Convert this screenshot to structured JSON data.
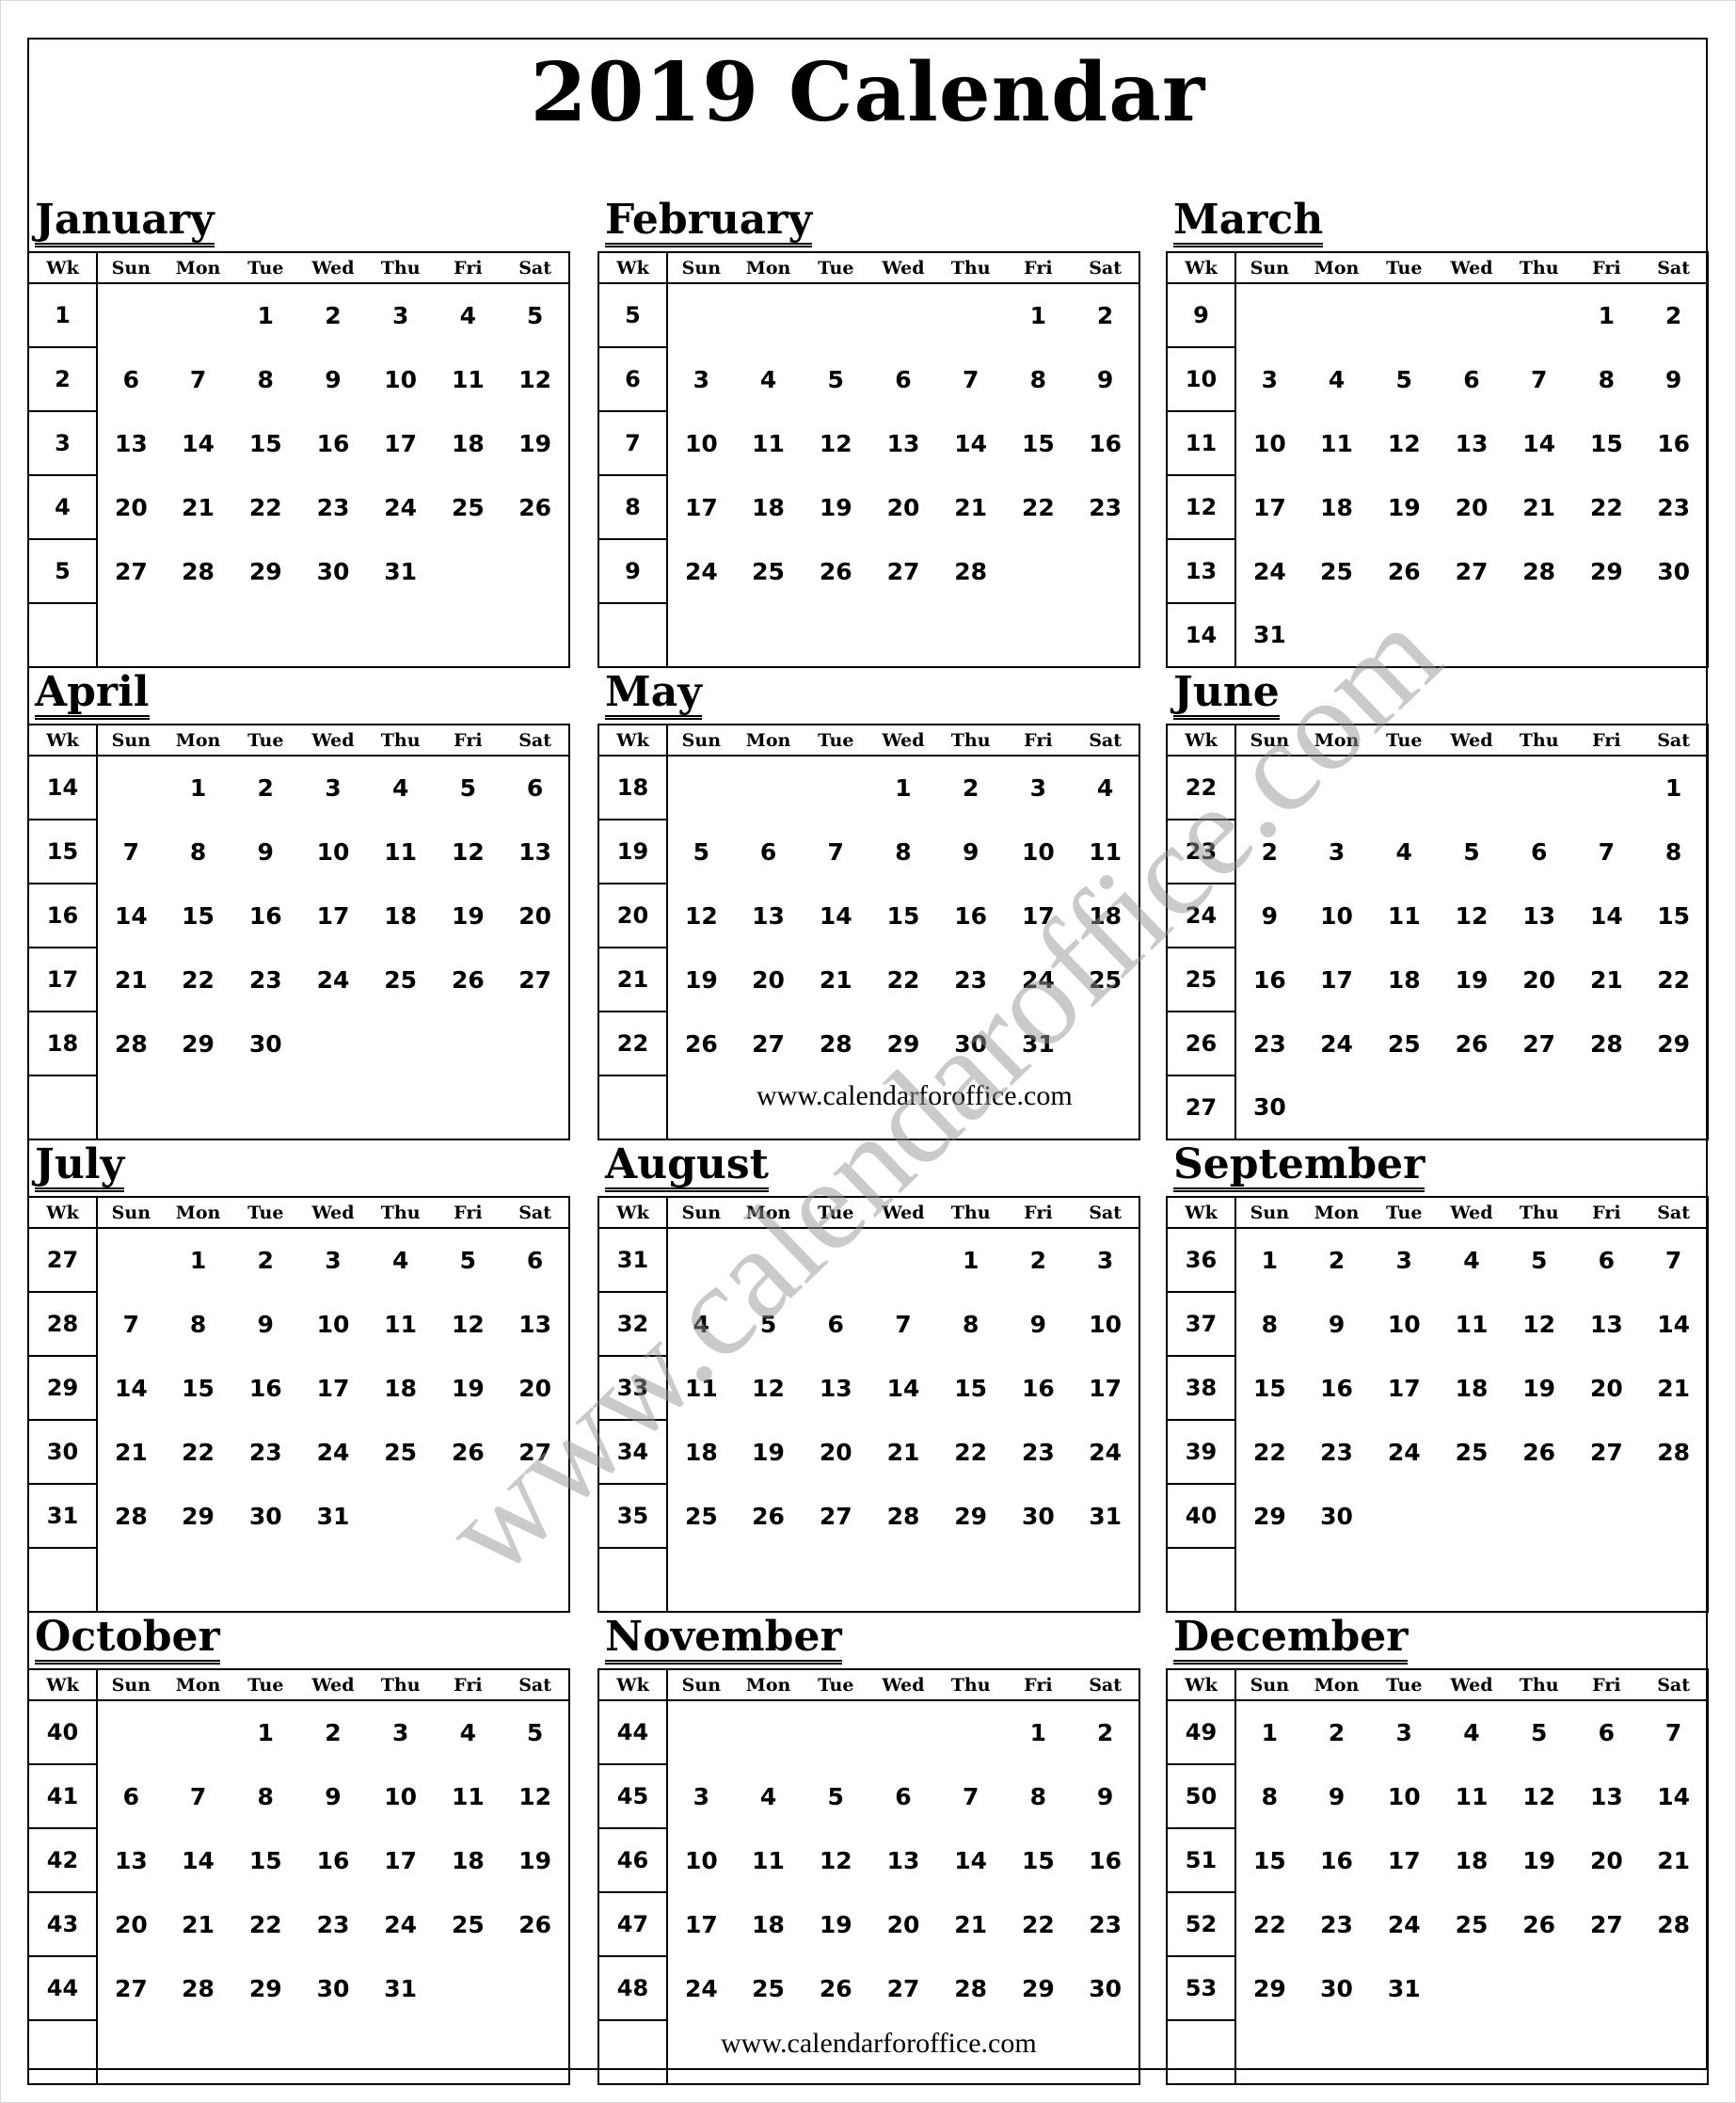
{
  "title": "2019 Calendar",
  "weekday_headers": [
    "Wk",
    "Sun",
    "Mon",
    "Tue",
    "Wed",
    "Thu",
    "Fri",
    "Sat"
  ],
  "watermark": "www.calendaroffice.com",
  "footer_urls": [
    "www.calendarforoffice.com",
    "www.calendarforoffice.com"
  ],
  "months": [
    {
      "name": "January",
      "weeks": [
        {
          "wk": "1",
          "days": [
            "",
            "",
            "1",
            "2",
            "3",
            "4",
            "5"
          ]
        },
        {
          "wk": "2",
          "days": [
            "6",
            "7",
            "8",
            "9",
            "10",
            "11",
            "12"
          ]
        },
        {
          "wk": "3",
          "days": [
            "13",
            "14",
            "15",
            "16",
            "17",
            "18",
            "19"
          ]
        },
        {
          "wk": "4",
          "days": [
            "20",
            "21",
            "22",
            "23",
            "24",
            "25",
            "26"
          ]
        },
        {
          "wk": "5",
          "days": [
            "27",
            "28",
            "29",
            "30",
            "31",
            "",
            ""
          ]
        },
        {
          "wk": "",
          "days": [
            "",
            "",
            "",
            "",
            "",
            "",
            ""
          ]
        }
      ]
    },
    {
      "name": "February",
      "weeks": [
        {
          "wk": "5",
          "days": [
            "",
            "",
            "",
            "",
            "",
            "1",
            "2"
          ]
        },
        {
          "wk": "6",
          "days": [
            "3",
            "4",
            "5",
            "6",
            "7",
            "8",
            "9"
          ]
        },
        {
          "wk": "7",
          "days": [
            "10",
            "11",
            "12",
            "13",
            "14",
            "15",
            "16"
          ]
        },
        {
          "wk": "8",
          "days": [
            "17",
            "18",
            "19",
            "20",
            "21",
            "22",
            "23"
          ]
        },
        {
          "wk": "9",
          "days": [
            "24",
            "25",
            "26",
            "27",
            "28",
            "",
            ""
          ]
        },
        {
          "wk": "",
          "days": [
            "",
            "",
            "",
            "",
            "",
            "",
            ""
          ]
        }
      ]
    },
    {
      "name": "March",
      "weeks": [
        {
          "wk": "9",
          "days": [
            "",
            "",
            "",
            "",
            "",
            "1",
            "2"
          ]
        },
        {
          "wk": "10",
          "days": [
            "3",
            "4",
            "5",
            "6",
            "7",
            "8",
            "9"
          ]
        },
        {
          "wk": "11",
          "days": [
            "10",
            "11",
            "12",
            "13",
            "14",
            "15",
            "16"
          ]
        },
        {
          "wk": "12",
          "days": [
            "17",
            "18",
            "19",
            "20",
            "21",
            "22",
            "23"
          ]
        },
        {
          "wk": "13",
          "days": [
            "24",
            "25",
            "26",
            "27",
            "28",
            "29",
            "30"
          ]
        },
        {
          "wk": "14",
          "days": [
            "31",
            "",
            "",
            "",
            "",
            "",
            ""
          ]
        }
      ]
    },
    {
      "name": "April",
      "weeks": [
        {
          "wk": "14",
          "days": [
            "",
            "1",
            "2",
            "3",
            "4",
            "5",
            "6"
          ]
        },
        {
          "wk": "15",
          "days": [
            "7",
            "8",
            "9",
            "10",
            "11",
            "12",
            "13"
          ]
        },
        {
          "wk": "16",
          "days": [
            "14",
            "15",
            "16",
            "17",
            "18",
            "19",
            "20"
          ]
        },
        {
          "wk": "17",
          "days": [
            "21",
            "22",
            "23",
            "24",
            "25",
            "26",
            "27"
          ]
        },
        {
          "wk": "18",
          "days": [
            "28",
            "29",
            "30",
            "",
            "",
            "",
            ""
          ]
        },
        {
          "wk": "",
          "days": [
            "",
            "",
            "",
            "",
            "",
            "",
            ""
          ]
        }
      ]
    },
    {
      "name": "May",
      "weeks": [
        {
          "wk": "18",
          "days": [
            "",
            "",
            "",
            "1",
            "2",
            "3",
            "4"
          ]
        },
        {
          "wk": "19",
          "days": [
            "5",
            "6",
            "7",
            "8",
            "9",
            "10",
            "11"
          ]
        },
        {
          "wk": "20",
          "days": [
            "12",
            "13",
            "14",
            "15",
            "16",
            "17",
            "18"
          ]
        },
        {
          "wk": "21",
          "days": [
            "19",
            "20",
            "21",
            "22",
            "23",
            "24",
            "25"
          ]
        },
        {
          "wk": "22",
          "days": [
            "26",
            "27",
            "28",
            "29",
            "30",
            "31",
            ""
          ]
        },
        {
          "wk": "",
          "days": [
            "",
            "",
            "",
            "",
            "",
            "",
            ""
          ]
        }
      ]
    },
    {
      "name": "June",
      "weeks": [
        {
          "wk": "22",
          "days": [
            "",
            "",
            "",
            "",
            "",
            "",
            "1"
          ]
        },
        {
          "wk": "23",
          "days": [
            "2",
            "3",
            "4",
            "5",
            "6",
            "7",
            "8"
          ]
        },
        {
          "wk": "24",
          "days": [
            "9",
            "10",
            "11",
            "12",
            "13",
            "14",
            "15"
          ]
        },
        {
          "wk": "25",
          "days": [
            "16",
            "17",
            "18",
            "19",
            "20",
            "21",
            "22"
          ]
        },
        {
          "wk": "26",
          "days": [
            "23",
            "24",
            "25",
            "26",
            "27",
            "28",
            "29"
          ]
        },
        {
          "wk": "27",
          "days": [
            "30",
            "",
            "",
            "",
            "",
            "",
            ""
          ]
        }
      ]
    },
    {
      "name": "July",
      "weeks": [
        {
          "wk": "27",
          "days": [
            "",
            "1",
            "2",
            "3",
            "4",
            "5",
            "6"
          ]
        },
        {
          "wk": "28",
          "days": [
            "7",
            "8",
            "9",
            "10",
            "11",
            "12",
            "13"
          ]
        },
        {
          "wk": "29",
          "days": [
            "14",
            "15",
            "16",
            "17",
            "18",
            "19",
            "20"
          ]
        },
        {
          "wk": "30",
          "days": [
            "21",
            "22",
            "23",
            "24",
            "25",
            "26",
            "27"
          ]
        },
        {
          "wk": "31",
          "days": [
            "28",
            "29",
            "30",
            "31",
            "",
            "",
            ""
          ]
        },
        {
          "wk": "",
          "days": [
            "",
            "",
            "",
            "",
            "",
            "",
            ""
          ]
        }
      ]
    },
    {
      "name": "August",
      "weeks": [
        {
          "wk": "31",
          "days": [
            "",
            "",
            "",
            "",
            "1",
            "2",
            "3"
          ]
        },
        {
          "wk": "32",
          "days": [
            "4",
            "5",
            "6",
            "7",
            "8",
            "9",
            "10"
          ]
        },
        {
          "wk": "33",
          "days": [
            "11",
            "12",
            "13",
            "14",
            "15",
            "16",
            "17"
          ]
        },
        {
          "wk": "34",
          "days": [
            "18",
            "19",
            "20",
            "21",
            "22",
            "23",
            "24"
          ]
        },
        {
          "wk": "35",
          "days": [
            "25",
            "26",
            "27",
            "28",
            "29",
            "30",
            "31"
          ]
        },
        {
          "wk": "",
          "days": [
            "",
            "",
            "",
            "",
            "",
            "",
            ""
          ]
        }
      ]
    },
    {
      "name": "September",
      "weeks": [
        {
          "wk": "36",
          "days": [
            "1",
            "2",
            "3",
            "4",
            "5",
            "6",
            "7"
          ]
        },
        {
          "wk": "37",
          "days": [
            "8",
            "9",
            "10",
            "11",
            "12",
            "13",
            "14"
          ]
        },
        {
          "wk": "38",
          "days": [
            "15",
            "16",
            "17",
            "18",
            "19",
            "20",
            "21"
          ]
        },
        {
          "wk": "39",
          "days": [
            "22",
            "23",
            "24",
            "25",
            "26",
            "27",
            "28"
          ]
        },
        {
          "wk": "40",
          "days": [
            "29",
            "30",
            "",
            "",
            "",
            "",
            ""
          ]
        },
        {
          "wk": "",
          "days": [
            "",
            "",
            "",
            "",
            "",
            "",
            ""
          ]
        }
      ]
    },
    {
      "name": "October",
      "weeks": [
        {
          "wk": "40",
          "days": [
            "",
            "",
            "1",
            "2",
            "3",
            "4",
            "5"
          ]
        },
        {
          "wk": "41",
          "days": [
            "6",
            "7",
            "8",
            "9",
            "10",
            "11",
            "12"
          ]
        },
        {
          "wk": "42",
          "days": [
            "13",
            "14",
            "15",
            "16",
            "17",
            "18",
            "19"
          ]
        },
        {
          "wk": "43",
          "days": [
            "20",
            "21",
            "22",
            "23",
            "24",
            "25",
            "26"
          ]
        },
        {
          "wk": "44",
          "days": [
            "27",
            "28",
            "29",
            "30",
            "31",
            "",
            ""
          ]
        },
        {
          "wk": "",
          "days": [
            "",
            "",
            "",
            "",
            "",
            "",
            ""
          ]
        }
      ]
    },
    {
      "name": "November",
      "weeks": [
        {
          "wk": "44",
          "days": [
            "",
            "",
            "",
            "",
            "",
            "1",
            "2"
          ]
        },
        {
          "wk": "45",
          "days": [
            "3",
            "4",
            "5",
            "6",
            "7",
            "8",
            "9"
          ]
        },
        {
          "wk": "46",
          "days": [
            "10",
            "11",
            "12",
            "13",
            "14",
            "15",
            "16"
          ]
        },
        {
          "wk": "47",
          "days": [
            "17",
            "18",
            "19",
            "20",
            "21",
            "22",
            "23"
          ]
        },
        {
          "wk": "48",
          "days": [
            "24",
            "25",
            "26",
            "27",
            "28",
            "29",
            "30"
          ]
        },
        {
          "wk": "",
          "days": [
            "",
            "",
            "",
            "",
            "",
            "",
            ""
          ]
        }
      ]
    },
    {
      "name": "December",
      "weeks": [
        {
          "wk": "49",
          "days": [
            "1",
            "2",
            "3",
            "4",
            "5",
            "6",
            "7"
          ]
        },
        {
          "wk": "50",
          "days": [
            "8",
            "9",
            "10",
            "11",
            "12",
            "13",
            "14"
          ]
        },
        {
          "wk": "51",
          "days": [
            "15",
            "16",
            "17",
            "18",
            "19",
            "20",
            "21"
          ]
        },
        {
          "wk": "52",
          "days": [
            "22",
            "23",
            "24",
            "25",
            "26",
            "27",
            "28"
          ]
        },
        {
          "wk": "53",
          "days": [
            "29",
            "30",
            "31",
            "",
            "",
            "",
            ""
          ]
        },
        {
          "wk": "",
          "days": [
            "",
            "",
            "",
            "",
            "",
            "",
            ""
          ]
        }
      ]
    }
  ]
}
